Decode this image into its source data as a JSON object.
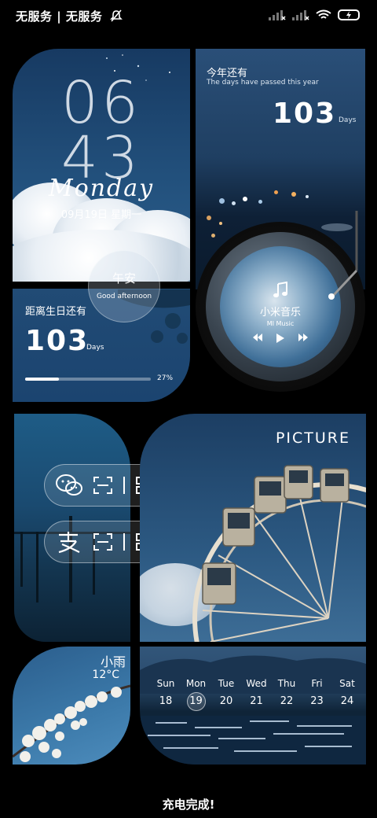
{
  "status_bar": {
    "carrier_text": "无服务 | 无服务",
    "icons": [
      "mute-bell-icon",
      "signal-1-icon",
      "signal-2-icon",
      "wifi-icon",
      "battery-charging-icon"
    ]
  },
  "clock_widget": {
    "hour": "06",
    "minute": "43",
    "weekday": "Monday",
    "date": "09月19日 星期一"
  },
  "year_widget": {
    "title": "今年还有",
    "subtitle": "The days have passed this year",
    "value": "103",
    "unit": "Days"
  },
  "greeting": {
    "title": "午安",
    "subtitle": "Good afternoon"
  },
  "birthday_widget": {
    "title": "距离生日还有",
    "value": "103",
    "unit": "Days",
    "progress_label": "27%",
    "progress": 0.27
  },
  "music_widget": {
    "title": "小米音乐",
    "subtitle": "MI Music",
    "controls": [
      "previous-icon",
      "play-icon",
      "next-icon"
    ]
  },
  "qr_widget": {
    "rows": [
      {
        "app": "wechat-icon",
        "actions": [
          "scan-icon",
          "qr-code-icon"
        ]
      },
      {
        "app": "alipay-icon",
        "actions": [
          "scan-icon",
          "qr-code-icon"
        ]
      }
    ]
  },
  "picture_widget": {
    "label": "PICTURE"
  },
  "weather_widget": {
    "condition": "小雨",
    "temperature": "12°C"
  },
  "calendar_widget": {
    "days": [
      {
        "name": "Sun",
        "date": "18"
      },
      {
        "name": "Mon",
        "date": "19"
      },
      {
        "name": "Tue",
        "date": "20"
      },
      {
        "name": "Wed",
        "date": "21"
      },
      {
        "name": "Thu",
        "date": "22"
      },
      {
        "name": "Fri",
        "date": "23"
      },
      {
        "name": "Sat",
        "date": "24"
      }
    ],
    "today_index": 1
  },
  "footer": {
    "text": "充电完成!"
  }
}
